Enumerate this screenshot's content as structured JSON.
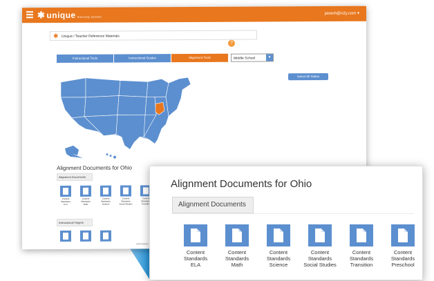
{
  "app": {
    "logo": "unique",
    "logo_sub": "learning system",
    "user": "jsteinh@n2y.com",
    "breadcrumb": {
      "home": "Unique",
      "sep": "/",
      "current": "Teacher Reference Materials"
    },
    "help": "?"
  },
  "tabs": [
    {
      "label": "Instructional Tools",
      "active": false
    },
    {
      "label": "Instructional Guides",
      "active": false
    },
    {
      "label": "Alignment Tools",
      "active": true
    }
  ],
  "grade_select": {
    "value": "Middle School"
  },
  "select_all_label": "Select All States",
  "map": {
    "highlighted_state": "Ohio",
    "base_color": "#5c8fcf",
    "highlight_color": "#e8771e"
  },
  "alignment": {
    "title": "Alignment Documents for Ohio",
    "section_label": "Alignment Documents",
    "documents": [
      {
        "line1": "Content",
        "line2": "Standards",
        "line3": "ELA"
      },
      {
        "line1": "Content",
        "line2": "Standards",
        "line3": "Math"
      },
      {
        "line1": "Content",
        "line2": "Standards",
        "line3": "Science"
      },
      {
        "line1": "Content",
        "line2": "Standards",
        "line3": "Social Studies"
      },
      {
        "line1": "Content",
        "line2": "Standards",
        "line3": "Transition"
      },
      {
        "line1": "Content",
        "line2": "Standards",
        "line3": "Preschool"
      }
    ],
    "section2_label": "Instructional Targets"
  },
  "copyright": "COPYRIGHT",
  "colors": {
    "accent": "#e8771e",
    "blue": "#5c8fcf"
  }
}
